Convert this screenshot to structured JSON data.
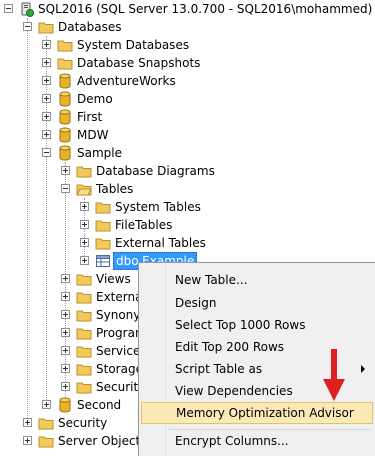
{
  "tree": {
    "server": "SQL2016 (SQL Server 13.0.700 - SQL2016\\mohammed)",
    "databases": "Databases",
    "system_databases": "System Databases",
    "database_snapshots": "Database Snapshots",
    "adventureworks": "AdventureWorks",
    "demo": "Demo",
    "first": "First",
    "mdw": "MDW",
    "sample": "Sample",
    "database_diagrams": "Database Diagrams",
    "tables": "Tables",
    "system_tables": "System Tables",
    "filetables": "FileTables",
    "external_tables": "External Tables",
    "dbo_example": "dbo.Example",
    "views": "Views",
    "external": "External",
    "synonyms": "Synonyr",
    "programmability": "Prograr",
    "service": "Service",
    "storage": "Storage",
    "security_db": "Security",
    "second": "Second",
    "security": "Security",
    "server_objects": "Server Objects"
  },
  "context_menu": {
    "items": [
      {
        "label": "New Table..."
      },
      {
        "label": "Design"
      },
      {
        "label": "Select Top 1000 Rows"
      },
      {
        "label": "Edit Top 200 Rows"
      },
      {
        "label": "Script Table as"
      },
      {
        "label": "View Dependencies"
      },
      {
        "label": "Memory Optimization Advisor"
      },
      {
        "label": "Encrypt Columns..."
      }
    ]
  },
  "colors": {
    "selection": "#3399ff",
    "menu_highlight": "#fce9b8",
    "folder": "#f3c95b",
    "database": "#e8b32a",
    "annotation_arrow": "#e02020"
  }
}
